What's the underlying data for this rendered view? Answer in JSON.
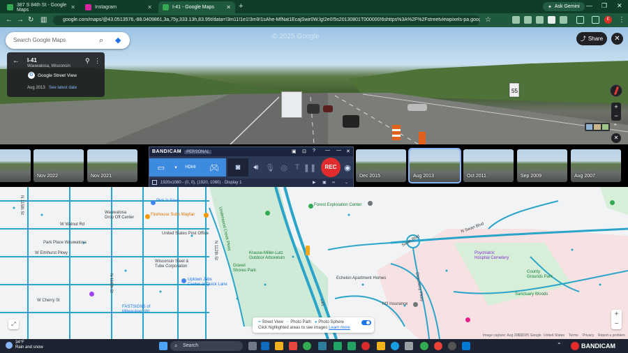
{
  "browser": {
    "tabs": [
      {
        "title": "387 S 84th St - Google Maps",
        "active": false
      },
      {
        "title": "Instagram",
        "active": false
      },
      {
        "title": "I-41 - Google Maps",
        "active": true
      }
    ],
    "new_tab": "+",
    "ask_gemini": "Ask Gemini",
    "url": "google.com/maps/@43.0513576,-88.0409861,3a,75y,333.13h,83.95t/data=!3m11!1e1!3m9!1sAhe-MfNat1EcajSwir0W.lg!2e0!5s20130801T000000!6shttps%3A%2F%2Fstreetviewpixels-pa.googleapis.com%2Fv1..."
  },
  "streetview": {
    "search_placeholder": "Search Google Maps",
    "road_name": "I-41",
    "location": "Wauwatosa, Wisconsin",
    "source": "Google Street View",
    "date": "Aug 2013",
    "see_latest": "See latest date",
    "share": "Share",
    "watermark": "© 2025 Google",
    "sign": "55"
  },
  "timeline": [
    {
      "label": "",
      "selected": false
    },
    {
      "label": "Nov 2022",
      "selected": false
    },
    {
      "label": "Nov 2021",
      "selected": false
    },
    {
      "label": "Dec 2015",
      "selected": false
    },
    {
      "label": "Aug 2013",
      "selected": true
    },
    {
      "label": "Oct 2011",
      "selected": false
    },
    {
      "label": "Sep 2009",
      "selected": false
    },
    {
      "label": "Aug 2007",
      "selected": false
    },
    {
      "label": "",
      "selected": false
    }
  ],
  "bandicam": {
    "brand": "BANDICAM",
    "license": "PERSONAL",
    "rec": "REC",
    "status": "1920x1080 - (0, 0), (1920, 1080) - Display 1",
    "mode_label": "HDMI"
  },
  "map": {
    "labels": [
      {
        "text": "Pick 'n Save",
        "color": "blue"
      },
      {
        "text": "Wauwatosa\nDrop Off Center",
        "color": "default"
      },
      {
        "text": "Firehouse Subs Mayfair",
        "color": "orange"
      },
      {
        "text": "United States Post Office",
        "color": "default"
      },
      {
        "text": "Forest Exploration Center",
        "color": "green"
      },
      {
        "text": "Krause-Miller-Lutz\nOutdoor Arboretum",
        "color": "green"
      },
      {
        "text": "Gravel\nShores Park",
        "color": "green"
      },
      {
        "text": "Underwood Creek Pkwy",
        "color": "green"
      },
      {
        "text": "Wisconsin Steel &\nTube Corporation",
        "color": "default"
      },
      {
        "text": "Uptown Jabs\nCenter at Quick Lane",
        "color": "blue"
      },
      {
        "text": "Park Place Wauwatosa",
        "color": "default"
      },
      {
        "text": "W Elmhurst Pkwy",
        "color": "default"
      },
      {
        "text": "W Walnut Rd",
        "color": "default"
      },
      {
        "text": "W Cherry St",
        "color": "default"
      },
      {
        "text": "N 115th St",
        "color": "default"
      },
      {
        "text": "N 116th St",
        "color": "default"
      },
      {
        "text": "N 112th St",
        "color": "default"
      },
      {
        "text": "Echelon Apartment Homes",
        "color": "default"
      },
      {
        "text": "M3 Insurance",
        "color": "default"
      },
      {
        "text": "Psychiatric\nHospital Cemetery",
        "color": "purple"
      },
      {
        "text": "County\nGrounds Park",
        "color": "green"
      },
      {
        "text": "Sanctuary Woods",
        "color": "green"
      },
      {
        "text": "FASTSIGNS of\nMilwaukee, WI",
        "color": "blue"
      },
      {
        "text": "Swan Blvd",
        "color": "default"
      },
      {
        "text": "I-41",
        "color": "default"
      },
      {
        "text": "Discovery Pkwy",
        "color": "default"
      },
      {
        "text": "N Swan Blvd",
        "color": "default"
      }
    ],
    "legend": {
      "street_view": "Street View",
      "photo_path": "Photo Path",
      "photo_sphere": "Photo Sphere",
      "hint": "Click highlighted areas to see images",
      "learn_more": "Learn more"
    },
    "attribution": [
      "Image capture: Aug 2013",
      "© 2025 Google",
      "United States",
      "Terms",
      "Privacy",
      "Report a problem"
    ]
  },
  "taskbar": {
    "temp": "34°F",
    "weather": "Rain and snow",
    "search": "Search"
  },
  "colors": {
    "chrome_dark": "#0f3d2a",
    "chrome_bar": "#1f5a3f",
    "rec_red": "#e02c2c",
    "sv_line": "#2aa5c9",
    "park_green": "#c8e6c9"
  }
}
